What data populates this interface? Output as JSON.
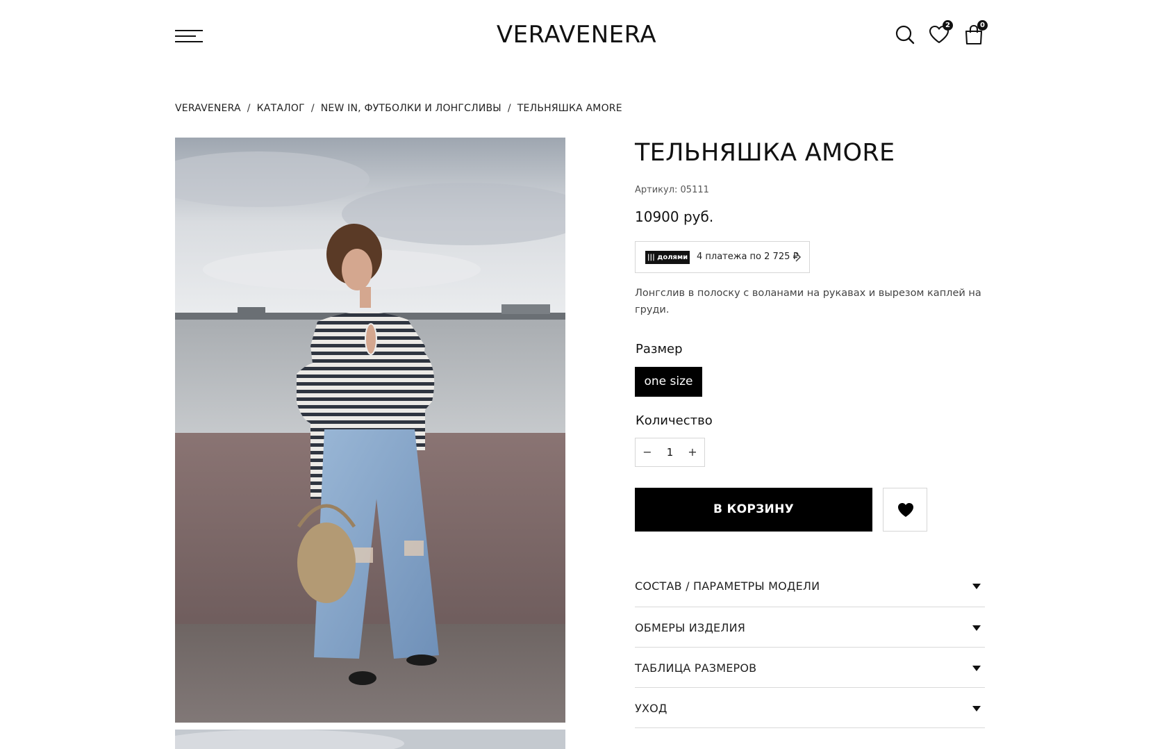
{
  "header": {
    "logo": "VERAVENERA",
    "wishlist_count": "2",
    "cart_count": "0"
  },
  "breadcrumb": {
    "items": [
      "VERAVENERA",
      "КАТАЛОГ",
      "NEW IN, ФУТБОЛКИ И ЛОНГСЛИВЫ",
      "ТЕЛЬНЯШКА AMORE"
    ],
    "separator": "/"
  },
  "product": {
    "title": "ТЕЛЬНЯШКА AMORE",
    "sku": "Артикул: 05111",
    "price": "10900 руб.",
    "split": {
      "logo": "||| долями",
      "text": "4 платежа по 2 725 ₽"
    },
    "description": "Лонгслив в полоску с воланами на рукавах и вырезом каплей на груди.",
    "size_label": "Размер",
    "size_selected": "one size",
    "qty_label": "Количество",
    "qty_value": "1",
    "qty_minus": "−",
    "qty_plus": "+",
    "cart_button": "В КОРЗИНУ"
  },
  "accordion": [
    {
      "label": "СОСТАВ / ПАРАМЕТРЫ МОДЕЛИ"
    },
    {
      "label": "ОБМЕРЫ ИЗДЕЛИЯ"
    },
    {
      "label": "ТАБЛИЦА РАЗМЕРОВ"
    },
    {
      "label": "УХОД"
    }
  ],
  "icons": {
    "menu": "menu-icon",
    "search": "search-icon",
    "wishlist": "heart-outline-icon",
    "cart": "bag-icon",
    "favorite": "heart-filled-icon"
  },
  "colors": {
    "primary": "#000000",
    "border": "#d6d6d6",
    "text": "#111111"
  }
}
